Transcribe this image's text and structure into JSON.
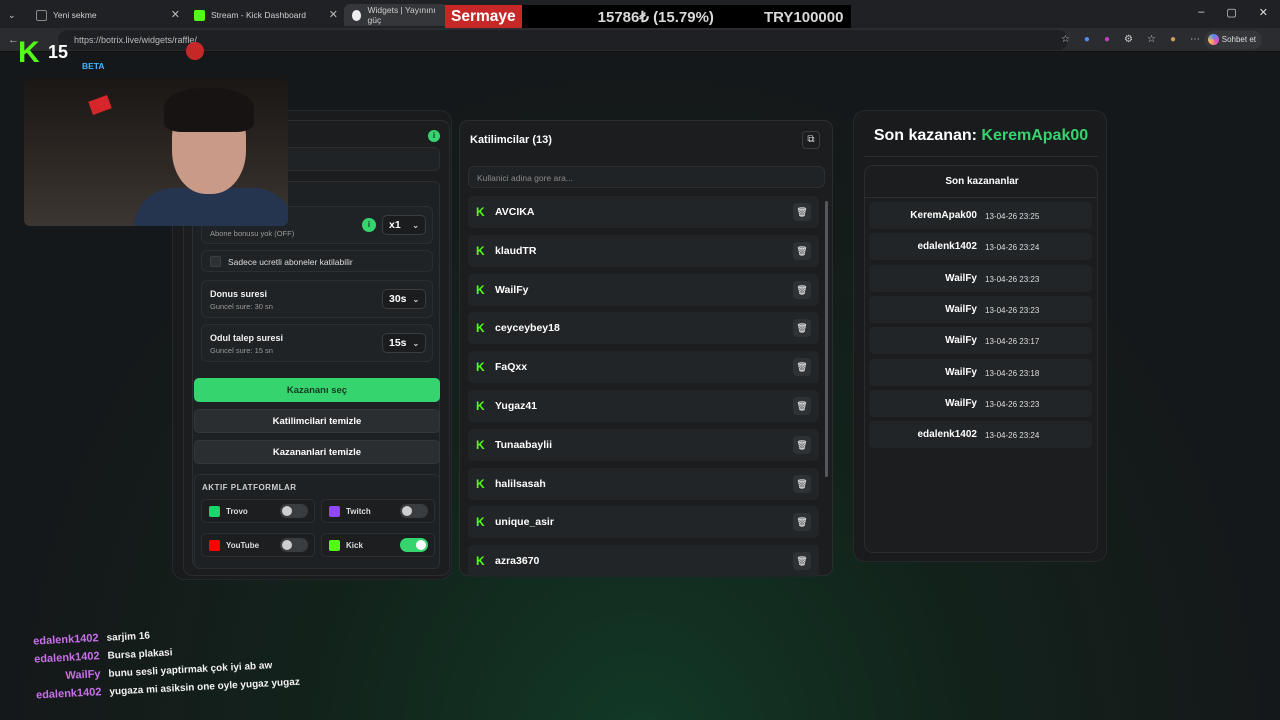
{
  "browser": {
    "tabs": [
      {
        "label": "Yeni sekme"
      },
      {
        "label": "Stream - Kick Dashboard"
      },
      {
        "label": "Widgets | Yayınını güç"
      }
    ],
    "url": "https://botrix.live/widgets/raffle/",
    "chat_button": "Sohbet et"
  },
  "ticker": {
    "label": "Sermaye",
    "change": "15786₺ (15.79%)",
    "amount": "TRY100000"
  },
  "overlay": {
    "logo_letter": "K",
    "logo_number": "15",
    "beta": "BETA"
  },
  "settings": {
    "sub_bonus_sub": "Abone bonusu yok (OFF)",
    "sub_bonus_value": "x1",
    "paid_only_label": "Sadece ucretli aboneler katilabilir",
    "round_label": "Donus suresi",
    "round_sub": "Guncel sure: 30 sn",
    "round_value": "30s",
    "claim_label": "Odul talep suresi",
    "claim_sub": "Guncel sure: 15 sn",
    "claim_value": "15s",
    "pick_winner": "Kazananı seç",
    "clear_participants": "Katilimcilari temizle",
    "clear_winners": "Kazananlari temizle",
    "platforms_title": "AKTIF PLATFORMLAR",
    "platforms": [
      {
        "name": "Trovo",
        "enabled": false,
        "icon": "trovo-icon",
        "color": "#19d66b"
      },
      {
        "name": "Twitch",
        "enabled": false,
        "icon": "twitch-icon",
        "color": "#9146ff"
      },
      {
        "name": "YouTube",
        "enabled": false,
        "icon": "youtube-icon",
        "color": "#ff0000"
      },
      {
        "name": "Kick",
        "enabled": true,
        "icon": "kick-icon",
        "color": "#53fc18"
      }
    ]
  },
  "participants": {
    "title": "Katilimcilar (13)",
    "search_placeholder": "Kullanici adina gore ara...",
    "list": [
      "AVCIKA",
      "klaudTR",
      "WailFy",
      "ceyceybey18",
      "FaQxx",
      "Yugaz41",
      "Tunaabaylii",
      "halilsasah",
      "unique_asir",
      "azra3670"
    ]
  },
  "winners": {
    "last_winner_prefix": "Son kazanan:",
    "last_winner_name": "KeremApak00",
    "recent_title": "Son kazananlar",
    "list": [
      {
        "name": "KeremApak00",
        "time": "13-04-26 23:25"
      },
      {
        "name": "edalenk1402",
        "time": "13-04-26 23:24"
      },
      {
        "name": "WailFy",
        "time": "13-04-26 23:23"
      },
      {
        "name": "WailFy",
        "time": "13-04-26 23:23"
      },
      {
        "name": "WailFy",
        "time": "13-04-26 23:17"
      },
      {
        "name": "WailFy",
        "time": "13-04-26 23:18"
      },
      {
        "name": "WailFy",
        "time": "13-04-26 23:23"
      },
      {
        "name": "edalenk1402",
        "time": "13-04-26 23:24"
      }
    ]
  },
  "chat": [
    {
      "user": "edalenk1402",
      "msg": "sarjim 16"
    },
    {
      "user": "edalenk1402",
      "msg": "Bursa plakasi"
    },
    {
      "user": "WailFy",
      "msg": "bunu sesli yaptirmak çok iyi ab aw"
    },
    {
      "user": "edalenk1402",
      "msg": "yugaza mi asiksin one oyle yugaz yugaz"
    }
  ],
  "colors": {
    "accent": "#36d46f",
    "kick": "#53fc18",
    "chat_user": "#c770e8"
  }
}
